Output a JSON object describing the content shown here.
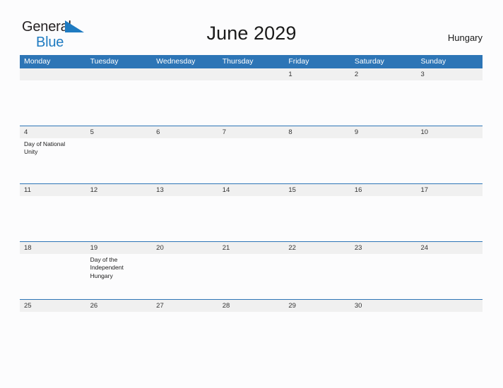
{
  "brand": {
    "name_part1": "General",
    "name_part2": "Blue",
    "flag_icon": "blue-triangle-flag-icon",
    "color_dark": "#231f20",
    "color_blue": "#1f7bc1"
  },
  "header": {
    "title": "June 2029",
    "country": "Hungary"
  },
  "theme": {
    "header_blue": "#2d75b6",
    "band_gray": "#f0f0f0",
    "background": "#fcfcfd",
    "text": "#1a1a1a"
  },
  "calendar": {
    "month": "June",
    "year": "2029",
    "weekday_headers": [
      "Monday",
      "Tuesday",
      "Wednesday",
      "Thursday",
      "Friday",
      "Saturday",
      "Sunday"
    ],
    "weeks": [
      [
        {
          "day": "",
          "events": []
        },
        {
          "day": "",
          "events": []
        },
        {
          "day": "",
          "events": []
        },
        {
          "day": "",
          "events": []
        },
        {
          "day": "1",
          "events": []
        },
        {
          "day": "2",
          "events": []
        },
        {
          "day": "3",
          "events": []
        }
      ],
      [
        {
          "day": "4",
          "events": [
            "Day of National Unity"
          ]
        },
        {
          "day": "5",
          "events": []
        },
        {
          "day": "6",
          "events": []
        },
        {
          "day": "7",
          "events": []
        },
        {
          "day": "8",
          "events": []
        },
        {
          "day": "9",
          "events": []
        },
        {
          "day": "10",
          "events": []
        }
      ],
      [
        {
          "day": "11",
          "events": []
        },
        {
          "day": "12",
          "events": []
        },
        {
          "day": "13",
          "events": []
        },
        {
          "day": "14",
          "events": []
        },
        {
          "day": "15",
          "events": []
        },
        {
          "day": "16",
          "events": []
        },
        {
          "day": "17",
          "events": []
        }
      ],
      [
        {
          "day": "18",
          "events": []
        },
        {
          "day": "19",
          "events": [
            "Day of the Independent Hungary"
          ]
        },
        {
          "day": "20",
          "events": []
        },
        {
          "day": "21",
          "events": []
        },
        {
          "day": "22",
          "events": []
        },
        {
          "day": "23",
          "events": []
        },
        {
          "day": "24",
          "events": []
        }
      ],
      [
        {
          "day": "25",
          "events": []
        },
        {
          "day": "26",
          "events": []
        },
        {
          "day": "27",
          "events": []
        },
        {
          "day": "28",
          "events": []
        },
        {
          "day": "29",
          "events": []
        },
        {
          "day": "30",
          "events": []
        },
        {
          "day": "",
          "events": []
        }
      ]
    ]
  }
}
